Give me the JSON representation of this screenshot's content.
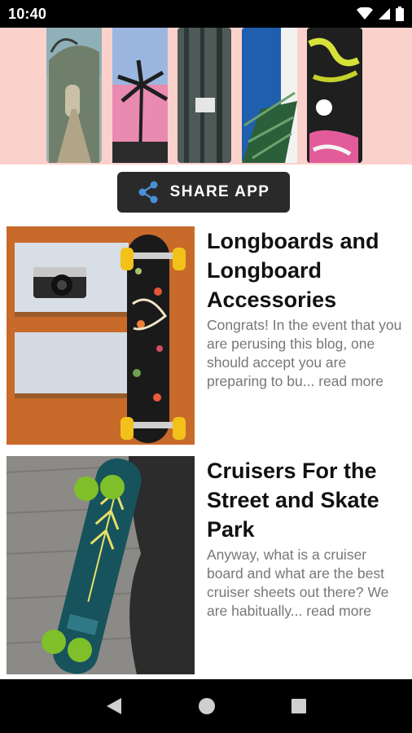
{
  "status_bar": {
    "time": "10:40",
    "icons": [
      "wifi-icon",
      "signal-icon",
      "battery-icon"
    ]
  },
  "share_button": {
    "label": "SHARE APP",
    "icon": "share-icon",
    "icon_color": "#4a90d9"
  },
  "articles": [
    {
      "title": "Longboards and Longboard Accessories",
      "excerpt": "Congrats! In the event that you are perusing this blog, one should accept you are preparing to bu...",
      "read_more": "read more"
    },
    {
      "title": "Cruisers For the Street and Skate Park",
      "excerpt": "Anyway, what is a cruiser board and what are the best cruiser sheets out there? We are habitually...",
      "read_more": "read more"
    }
  ],
  "nav_bar": {
    "icons": [
      "back-icon",
      "home-icon",
      "recents-icon"
    ]
  },
  "colors": {
    "banner_background": "#fbd2cb",
    "share_button_background": "#2a2a2a",
    "excerpt_text": "#777777"
  }
}
